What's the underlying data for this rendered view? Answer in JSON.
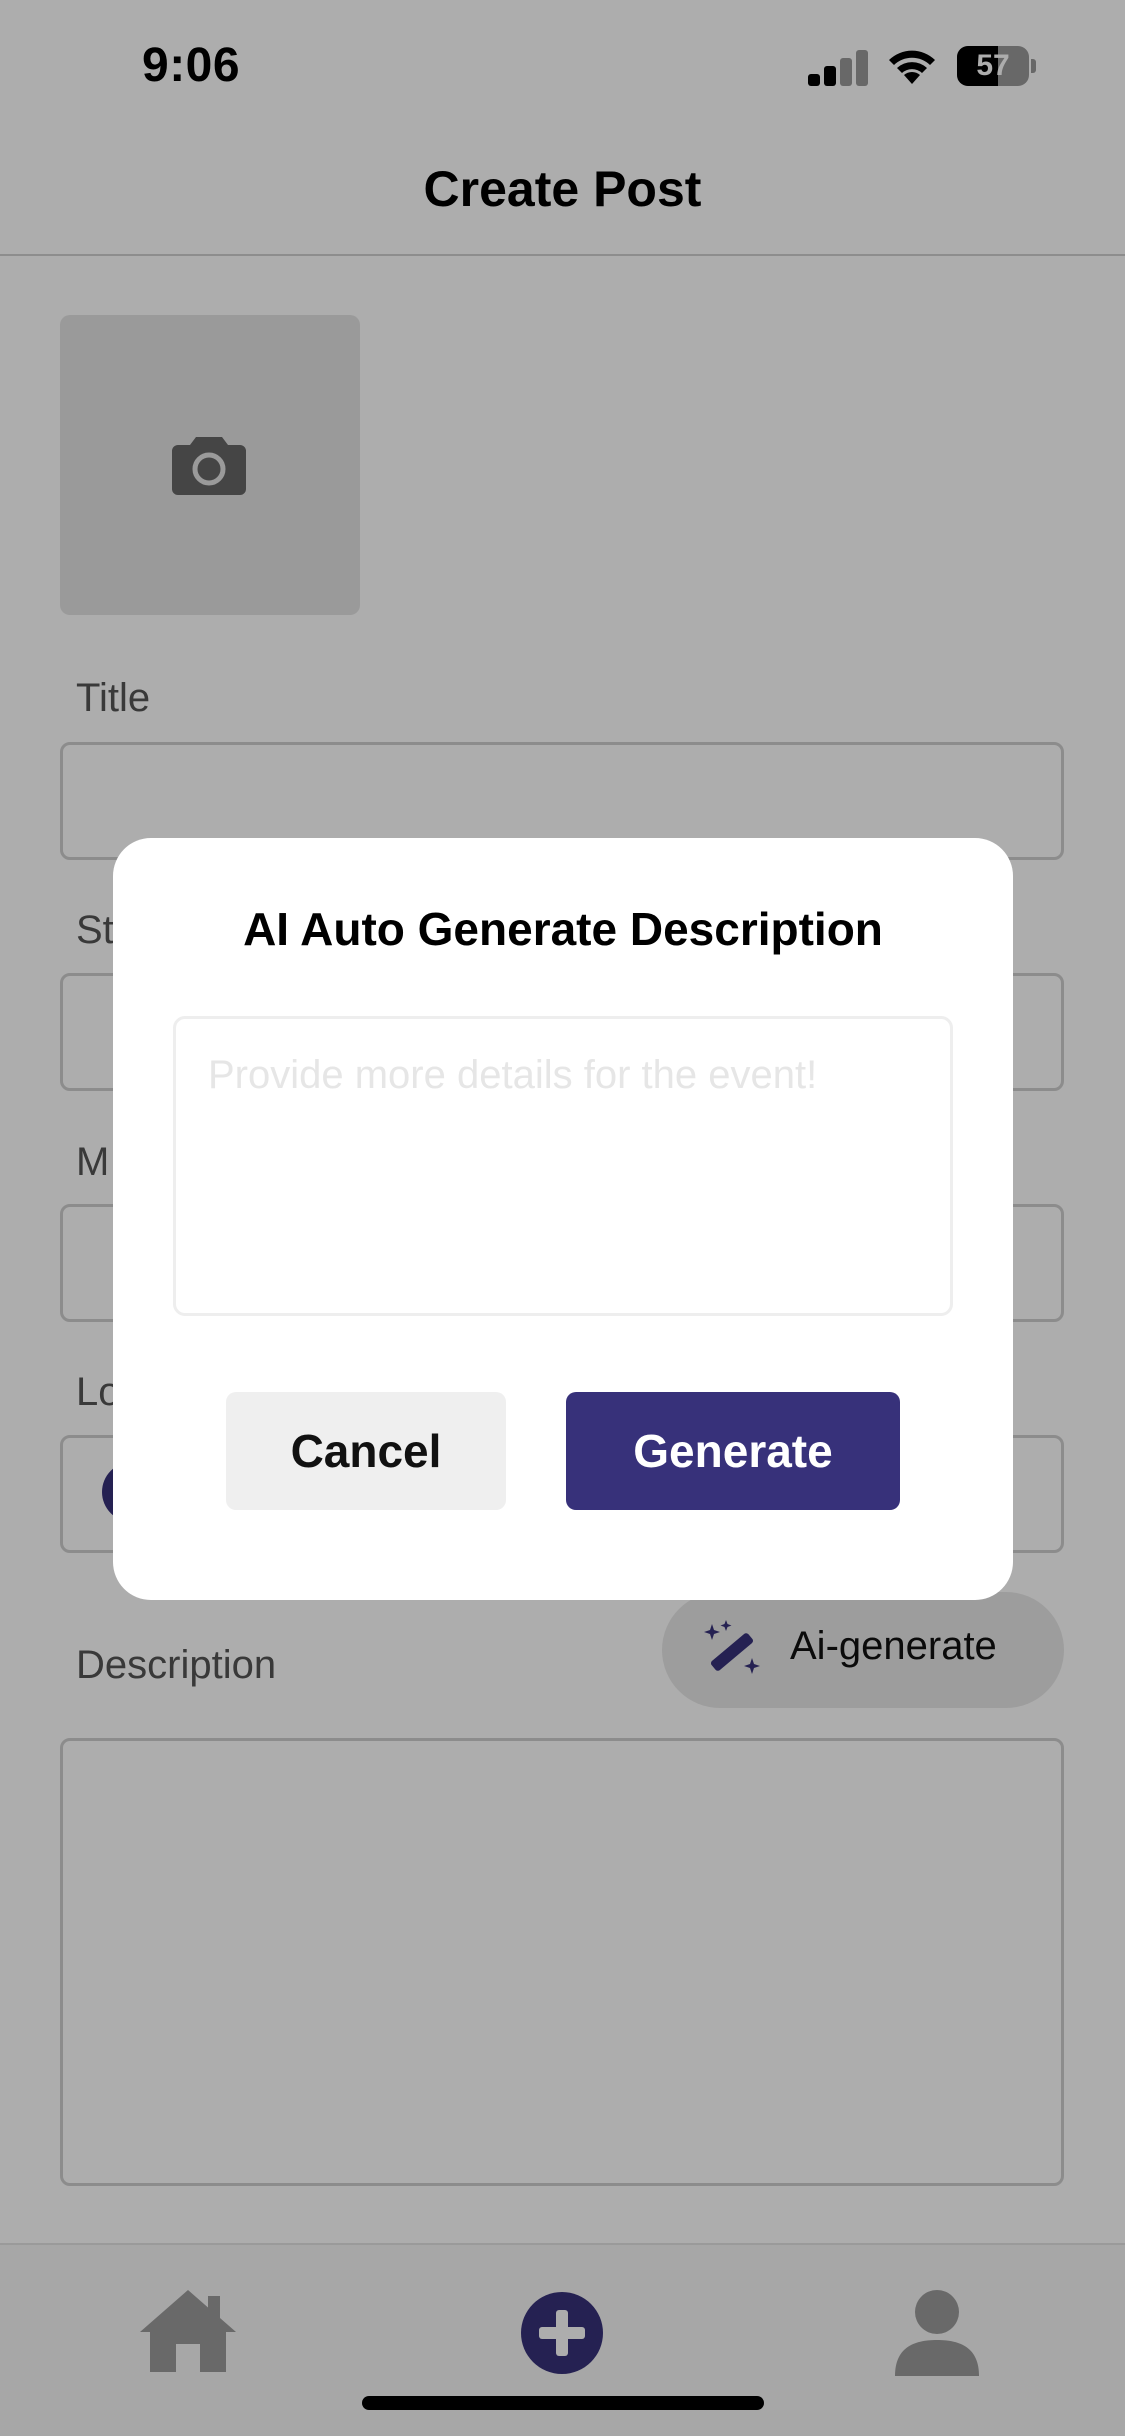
{
  "status_bar": {
    "time": "9:06",
    "battery": "57",
    "battery_level": 0.57,
    "icons": [
      "cellular-signal-icon",
      "wifi-icon",
      "battery-icon"
    ]
  },
  "header": {
    "title": "Create Post"
  },
  "form": {
    "photo_icon": "camera-icon",
    "title_label": "Title",
    "start_label_partial": "St",
    "middle_label_partial": "M",
    "location_label_partial": "Lo",
    "description_label": "Description",
    "ai_button_label": "Ai-generate",
    "ai_button_icon": "magic-wand-icon"
  },
  "modal": {
    "title": "AI Auto Generate Description",
    "input_placeholder": "Provide more details for the event!",
    "cancel_label": "Cancel",
    "generate_label": "Generate"
  },
  "tab_bar": {
    "tabs": [
      {
        "name": "home",
        "icon": "home-icon"
      },
      {
        "name": "create",
        "icon": "plus-circle-icon"
      },
      {
        "name": "profile",
        "icon": "user-icon"
      }
    ]
  },
  "colors": {
    "accent": "#37317a",
    "overlay": "rgba(0,0,0,0.32)",
    "field_border": "#cfcfcf"
  }
}
